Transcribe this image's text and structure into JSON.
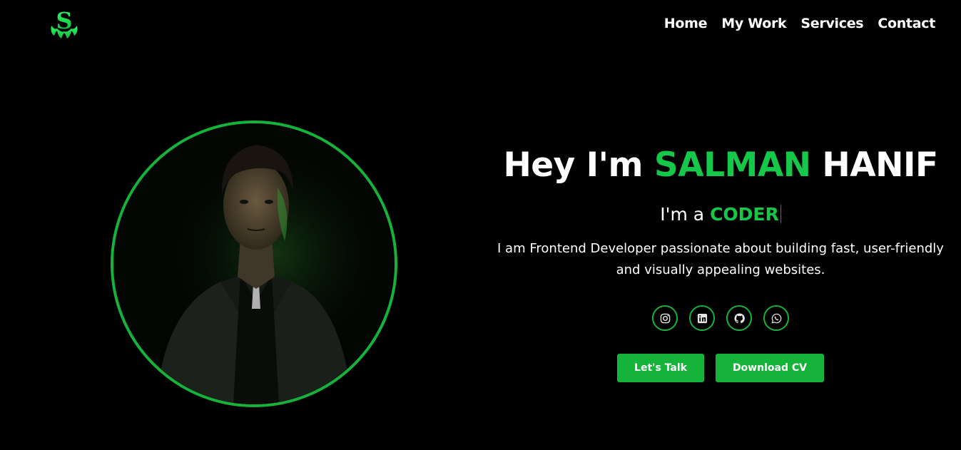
{
  "brand": {
    "logo_letter": "S",
    "accent_color": "#16c84a"
  },
  "nav": {
    "items": [
      {
        "label": "Home"
      },
      {
        "label": "My Work"
      },
      {
        "label": "Services"
      },
      {
        "label": "Contact"
      }
    ]
  },
  "hero": {
    "greeting": "Hey I'm",
    "first_name": "SALMAN",
    "last_name": "HANIF",
    "role_prefix": "I'm a",
    "role": "CODER",
    "description": "I am Frontend Developer passionate about building fast, user-friendly and visually appealing websites.",
    "socials": [
      {
        "icon": "instagram-icon"
      },
      {
        "icon": "linkedin-icon"
      },
      {
        "icon": "github-icon"
      },
      {
        "icon": "whatsapp-icon"
      }
    ],
    "buttons": {
      "talk_label": "Let's Talk",
      "cv_label": "Download CV"
    }
  }
}
